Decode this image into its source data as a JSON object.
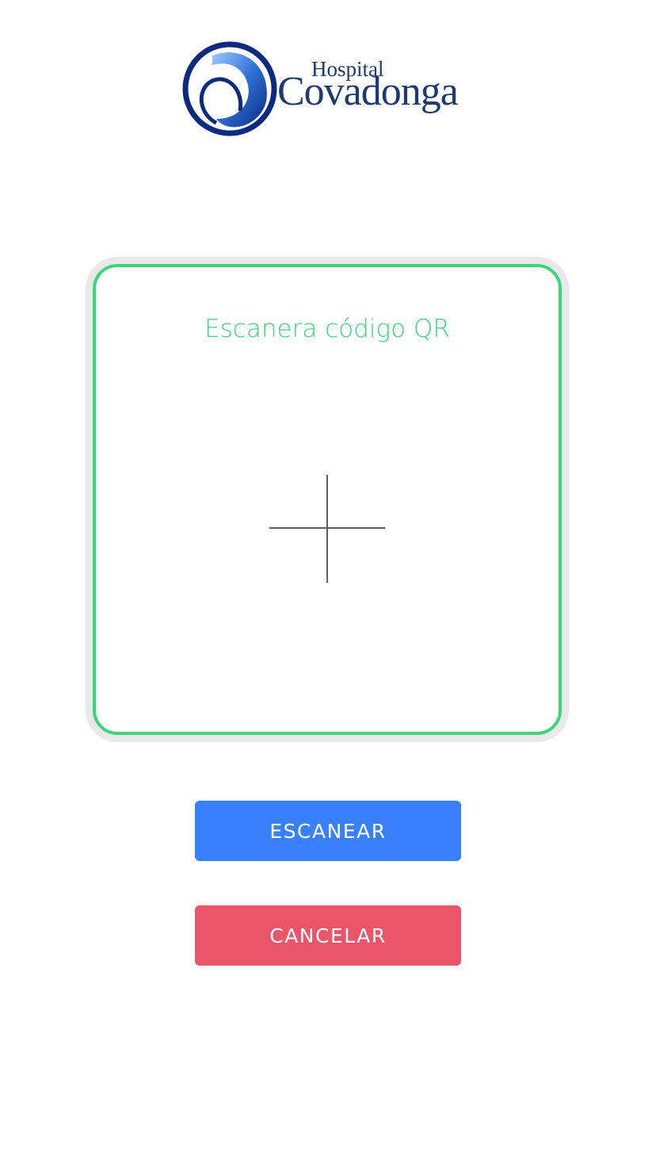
{
  "logo": {
    "line1": "Hospital",
    "line2": "Covadonga"
  },
  "scanner": {
    "title": "Escanera código QR"
  },
  "buttons": {
    "scan": "ESCANEAR",
    "cancel": "CANCELAR"
  },
  "colors": {
    "frame": "#3ed47a",
    "scan": "#3880ff",
    "cancel": "#eb5569"
  }
}
